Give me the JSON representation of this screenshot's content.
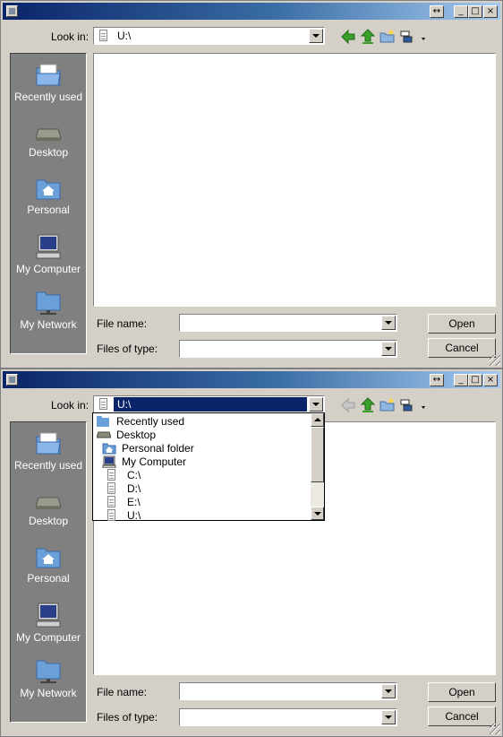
{
  "dialogs": [
    {
      "title_buttons": [
        "↔",
        "_",
        "□",
        "×"
      ],
      "look_in": {
        "label": "Look in:",
        "value": "U:\\"
      },
      "sidebar": [
        {
          "label": "Recently used",
          "icon": "recent-folder-icon"
        },
        {
          "label": "Desktop",
          "icon": "desktop-icon"
        },
        {
          "label": "Personal",
          "icon": "home-folder-icon"
        },
        {
          "label": "My Computer",
          "icon": "computer-icon"
        },
        {
          "label": "My Network",
          "icon": "network-icon"
        }
      ],
      "file_name": {
        "label": "File name:",
        "value": ""
      },
      "files_of_type": {
        "label": "Files of type:",
        "value": ""
      },
      "buttons": {
        "open": "Open",
        "cancel": "Cancel"
      }
    },
    {
      "title_buttons": [
        "↔",
        "_",
        "□",
        "×"
      ],
      "look_in": {
        "label": "Look in:",
        "value": "U:\\"
      },
      "look_in_dropdown": [
        {
          "label": "Recently used",
          "icon": "recent-folder-icon",
          "indent": 0
        },
        {
          "label": "Desktop",
          "icon": "desktop-icon",
          "indent": 0
        },
        {
          "label": "Personal folder",
          "icon": "home-folder-icon",
          "indent": 1
        },
        {
          "label": "My Computer",
          "icon": "computer-icon",
          "indent": 1
        },
        {
          "label": "C:\\",
          "icon": "drive-icon",
          "indent": 2
        },
        {
          "label": "D:\\",
          "icon": "drive-icon",
          "indent": 2
        },
        {
          "label": "E:\\",
          "icon": "drive-icon",
          "indent": 2
        },
        {
          "label": "U:\\",
          "icon": "drive-icon",
          "indent": 2
        }
      ],
      "sidebar": [
        {
          "label": "Recently used",
          "icon": "recent-folder-icon"
        },
        {
          "label": "Desktop",
          "icon": "desktop-icon"
        },
        {
          "label": "Personal",
          "icon": "home-folder-icon"
        },
        {
          "label": "My Computer",
          "icon": "computer-icon"
        },
        {
          "label": "My Network",
          "icon": "network-icon"
        }
      ],
      "file_name": {
        "label": "File name:",
        "value": ""
      },
      "files_of_type": {
        "label": "Files of type:",
        "value": ""
      },
      "buttons": {
        "open": "Open",
        "cancel": "Cancel"
      }
    }
  ],
  "colors": {
    "dialog_bg": "#d4d0c8",
    "title_gradient_start": "#0a246a",
    "title_gradient_end": "#a6caf0",
    "sidebar_bg": "#808080",
    "selection": "#0a246a",
    "back_arrow_green": "#3aa02a"
  }
}
